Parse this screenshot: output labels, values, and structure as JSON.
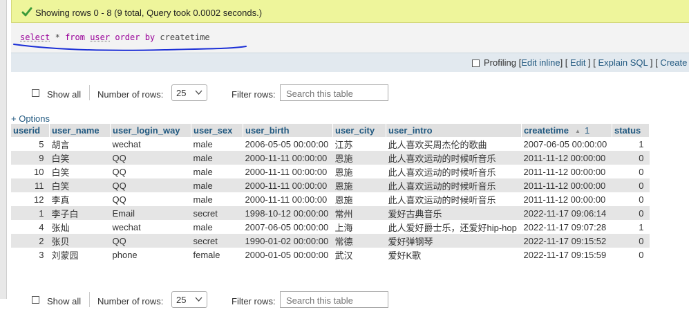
{
  "notice": {
    "text": "Showing rows 0 - 8 (9 total, Query took 0.0002 seconds.)",
    "icon": "success-check-icon",
    "color": "#3a9b3a"
  },
  "sql": {
    "select": "select",
    "star": "*",
    "from": "from",
    "table": "user",
    "order": "order",
    "by": "by",
    "column": "createtime"
  },
  "profiling": {
    "label": "Profiling",
    "edit_inline": "Edit inline",
    "edit": "Edit",
    "explain_sql": "Explain SQL",
    "create": "Create"
  },
  "controls_top": {
    "show_all": "Show all",
    "number_of_rows_label": "Number of rows:",
    "rows_value": "25",
    "filter_label": "Filter rows:",
    "filter_placeholder": "Search this table"
  },
  "controls_bottom": {
    "show_all": "Show all",
    "number_of_rows_label": "Number of rows:",
    "rows_value": "25",
    "filter_label": "Filter rows:",
    "filter_placeholder": "Search this table"
  },
  "options_label": "+ Options",
  "table": {
    "columns": [
      "userid",
      "user_name",
      "user_login_way",
      "user_sex",
      "user_birth",
      "user_city",
      "user_intro",
      "createtime",
      "status"
    ],
    "sort_number": "1",
    "rows": [
      [
        "5",
        "胡言",
        "wechat",
        "male",
        "2006-05-05 00:00:00",
        "江苏",
        "此人喜欢买周杰伦的歌曲",
        "2007-06-05 00:00:00",
        "1"
      ],
      [
        "9",
        "白笑",
        "QQ",
        "male",
        "2000-11-11 00:00:00",
        "恩施",
        "此人喜欢运动的时候听音乐",
        "2011-11-12 00:00:00",
        "0"
      ],
      [
        "10",
        "白笑",
        "QQ",
        "male",
        "2000-11-11 00:00:00",
        "恩施",
        "此人喜欢运动的时候听音乐",
        "2011-11-12 00:00:00",
        "0"
      ],
      [
        "11",
        "白笑",
        "QQ",
        "male",
        "2000-11-11 00:00:00",
        "恩施",
        "此人喜欢运动的时候听音乐",
        "2011-11-12 00:00:00",
        "0"
      ],
      [
        "12",
        "李真",
        "QQ",
        "male",
        "2000-11-11 00:00:00",
        "恩施",
        "此人喜欢运动的时候听音乐",
        "2011-11-12 00:00:00",
        "0"
      ],
      [
        "1",
        "李子白",
        "Email",
        "secret",
        "1998-10-12 00:00:00",
        "常州",
        "爱好古典音乐",
        "2022-11-17 09:06:14",
        "0"
      ],
      [
        "4",
        "张灿",
        "wechat",
        "male",
        "2007-06-05 00:00:00",
        "上海",
        "此人爱好爵士乐，还爱好hip-hop",
        "2022-11-17 09:07:28",
        "1"
      ],
      [
        "2",
        "张贝",
        "QQ",
        "secret",
        "1990-01-02 00:00:00",
        "常德",
        "爱好弹钢琴",
        "2022-11-17 09:15:52",
        "0"
      ],
      [
        "3",
        "刘蒙园",
        "phone",
        "female",
        "2000-01-05 00:00:00",
        "武汉",
        "爱好K歌",
        "2022-11-17 09:15:59",
        "0"
      ]
    ]
  }
}
